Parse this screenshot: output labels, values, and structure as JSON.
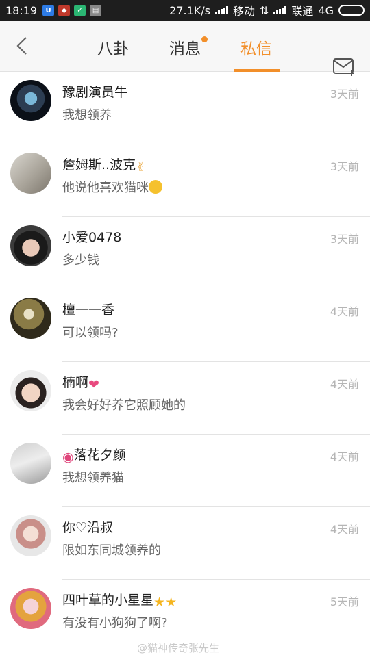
{
  "status_bar": {
    "time": "18:19",
    "speed": "27.1K/s",
    "carrier1": "移动",
    "carrier2": "联通",
    "network": "4G"
  },
  "header": {
    "tabs": [
      {
        "label": "八卦"
      },
      {
        "label": "消息"
      },
      {
        "label": "私信"
      }
    ],
    "accent_color": "#f28f2a"
  },
  "messages": [
    {
      "name": "豫剧演员牛",
      "text": "我想领养",
      "time": "3天前"
    },
    {
      "name": "詹姆斯..波克",
      "text": "他说他喜欢猫咪",
      "time": "3天前"
    },
    {
      "name": "小爱0478",
      "text": "多少钱",
      "time": "3天前"
    },
    {
      "name": "檀一一香",
      "text": "可以领吗?",
      "time": "4天前"
    },
    {
      "name": "楠啊",
      "text": "我会好好养它照顾她的",
      "time": "4天前"
    },
    {
      "name": "落花夕颜",
      "text": "我想领养猫",
      "time": "4天前"
    },
    {
      "name": "你♡沿叔",
      "text": "限如东同城领养的",
      "time": "4天前"
    },
    {
      "name": "四叶草的小星星",
      "text": "有没有小狗狗了啊?",
      "time": "5天前"
    }
  ],
  "watermark": "@猫神传奇张先生"
}
